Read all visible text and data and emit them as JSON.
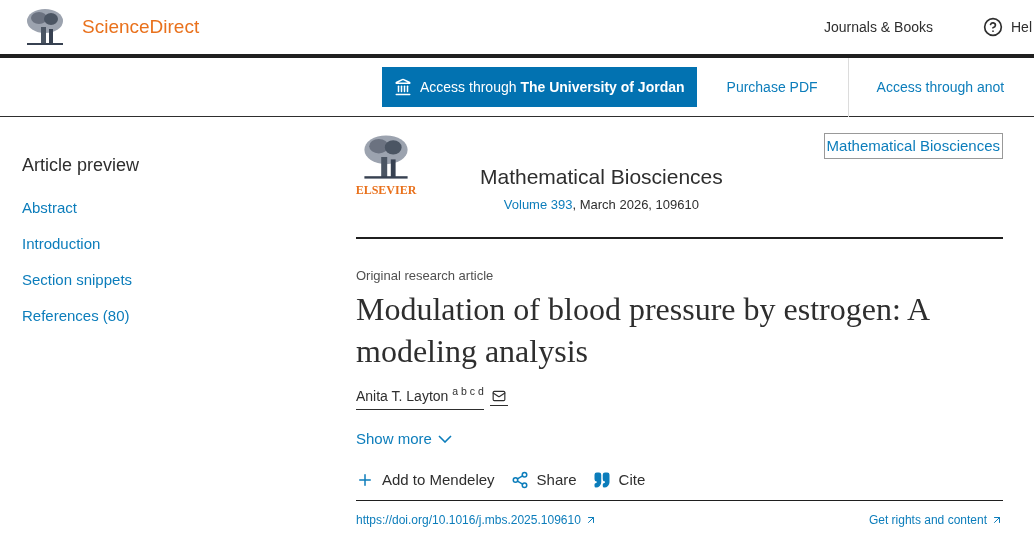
{
  "header": {
    "brand": "ScienceDirect",
    "nav": [
      {
        "label": "Journals & Books",
        "kind": "link"
      },
      {
        "label": "Hel",
        "kind": "help"
      }
    ]
  },
  "access_bar": {
    "institution_button": {
      "prefix": "Access through ",
      "institution": "The University of Jordan"
    },
    "purchase": "Purchase PDF",
    "other": "Access through anot"
  },
  "sidebar": {
    "title": "Article preview",
    "items": [
      {
        "label": "Abstract"
      },
      {
        "label": "Introduction"
      },
      {
        "label": "Section snippets"
      },
      {
        "label": "References (80)"
      }
    ]
  },
  "journal": {
    "publisher": "ELSEVIER",
    "name": "Mathematical Biosciences",
    "volume": "Volume 393",
    "details": ", March 2026, 109610",
    "cover_alt": "Mathematical Biosciences"
  },
  "article": {
    "type": "Original research article",
    "title": "Modulation of blood pressure by estrogen: A modeling analysis",
    "author": "Anita T. Layton $^{a b c d}$",
    "show_more": "Show more",
    "actions": [
      {
        "kind": "add",
        "label": "Add to Mendeley"
      },
      {
        "kind": "share",
        "label": "Share"
      },
      {
        "kind": "cite",
        "label": "Cite"
      }
    ],
    "doi": "https://doi.org/10.1016/j.mbs.2025.109610",
    "rights": "Get rights and content"
  }
}
